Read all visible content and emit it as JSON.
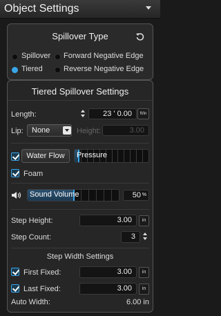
{
  "header": {
    "title": "Object Settings"
  },
  "spillover_type": {
    "title": "Spillover Type",
    "options": [
      {
        "label": "Spillover",
        "selected": false
      },
      {
        "label": "Forward Negative Edge",
        "selected": false
      },
      {
        "label": "Tiered",
        "selected": true
      },
      {
        "label": "Reverse Negative Edge",
        "selected": false
      }
    ]
  },
  "tiered": {
    "title": "Tiered Spillover Settings",
    "length_label": "Length:",
    "length_value": "23 ' 0.00",
    "length_unit": "ft/in",
    "lip_label": "Lip:",
    "lip_value": "None",
    "height_label": "Height:",
    "height_value": "3.00",
    "water_flow_label": "Water Flow",
    "water_flow_checked": true,
    "pressure_label": "Pressure",
    "pressure_fraction": 0.05,
    "foam_label": "Foam",
    "foam_checked": true,
    "sound_label": "Sound Volume",
    "sound_percent": 50,
    "sound_value": "50",
    "sound_unit": "%",
    "step_height_label": "Step Height:",
    "step_height_value": "3.00",
    "step_height_unit": "in",
    "step_count_label": "Step Count:",
    "step_count_value": "3"
  },
  "step_width": {
    "title": "Step Width Settings",
    "first_label": "First Fixed:",
    "first_checked": true,
    "first_value": "3.00",
    "first_unit": "in",
    "last_label": "Last Fixed:",
    "last_checked": true,
    "last_value": "3.00",
    "last_unit": "in",
    "auto_label": "Auto Width:",
    "auto_value": "6.00 in"
  },
  "colors": {
    "accent": "#3aa6ea",
    "background": "#1a1a1a",
    "panel": "#2a2a2a"
  }
}
